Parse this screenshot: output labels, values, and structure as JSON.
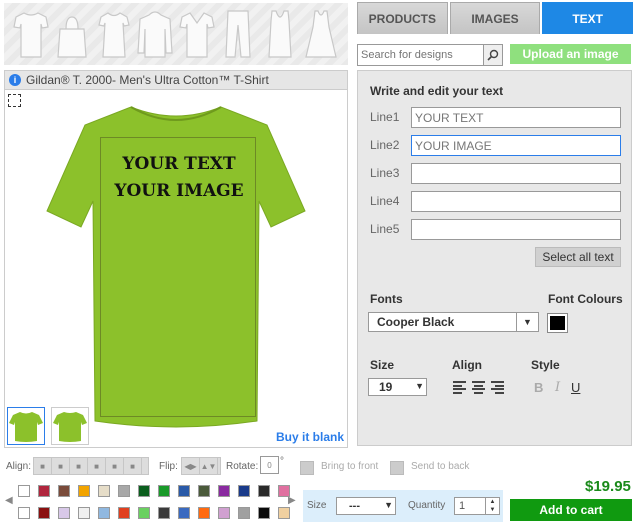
{
  "product_strip": {
    "items": [
      {
        "icon": "tshirt-icon"
      },
      {
        "icon": "tote-bag-icon"
      },
      {
        "icon": "womens-tee-icon"
      },
      {
        "icon": "hoodie-icon"
      },
      {
        "icon": "vneck-icon"
      },
      {
        "icon": "pants-icon"
      },
      {
        "icon": "tank-top-icon"
      },
      {
        "icon": "dress-icon"
      }
    ]
  },
  "tabs": [
    {
      "label": "PRODUCTS",
      "active": false
    },
    {
      "label": "IMAGES",
      "active": false
    },
    {
      "label": "TEXT",
      "active": true
    }
  ],
  "search": {
    "placeholder": "Search for designs"
  },
  "upload_label": "Upload an image",
  "product": {
    "name": "Gildan® T. 2000- Men's Ultra Cotton™ T-Shirt",
    "shirt_color": "#8cc12b"
  },
  "design": {
    "lines": [
      "YOUR TEXT",
      "YOUR IMAGE"
    ]
  },
  "buy_blank": "Buy it blank",
  "text_panel": {
    "title": "Write and edit your text",
    "lines": [
      {
        "label": "Line1",
        "value": "YOUR TEXT"
      },
      {
        "label": "Line2",
        "value": "YOUR IMAGE"
      },
      {
        "label": "Line3",
        "value": ""
      },
      {
        "label": "Line4",
        "value": ""
      },
      {
        "label": "Line5",
        "value": ""
      }
    ],
    "select_all": "Select all text",
    "fonts_label": "Fonts",
    "font_value": "Cooper Black",
    "font_colours_label": "Font Colours",
    "font_colour": "#000000",
    "size_label": "Size",
    "size_value": "19",
    "align_label": "Align",
    "style_label": "Style",
    "style_bold": "B",
    "style_italic": "I",
    "style_underline": "U"
  },
  "toolbar": {
    "align": "Align:",
    "flip": "Flip:",
    "rotate": "Rotate:",
    "rotate_value": "0",
    "degree": "°",
    "bring_front": "Bring to front",
    "send_back": "Send to back"
  },
  "palette": {
    "colors": [
      "#ffffff",
      "#b0263d",
      "#7a4b3a",
      "#f2a400",
      "#e6ddc8",
      "#a8a8a8",
      "#0b5e1e",
      "#1a9a2a",
      "#2a5aa8",
      "#4a5a3a",
      "#8a2aa0",
      "#1a3a8a",
      "#2a2a2a",
      "#e070a0",
      "#ffffff",
      "#8a1010",
      "#d8c8e8",
      "#f0f0f0",
      "#90b8e0",
      "#e04020",
      "#6ad060",
      "#3a3a3a",
      "#3a6ac0",
      "#ff6a10",
      "#d0a0d0",
      "#a0a0a0",
      "#0a0a0a",
      "#f0d0a0"
    ]
  },
  "size": {
    "label": "Size",
    "value": "---"
  },
  "quantity": {
    "label": "Quantity",
    "value": "1"
  },
  "price": "$19.95",
  "add_to_cart": "Add to cart"
}
